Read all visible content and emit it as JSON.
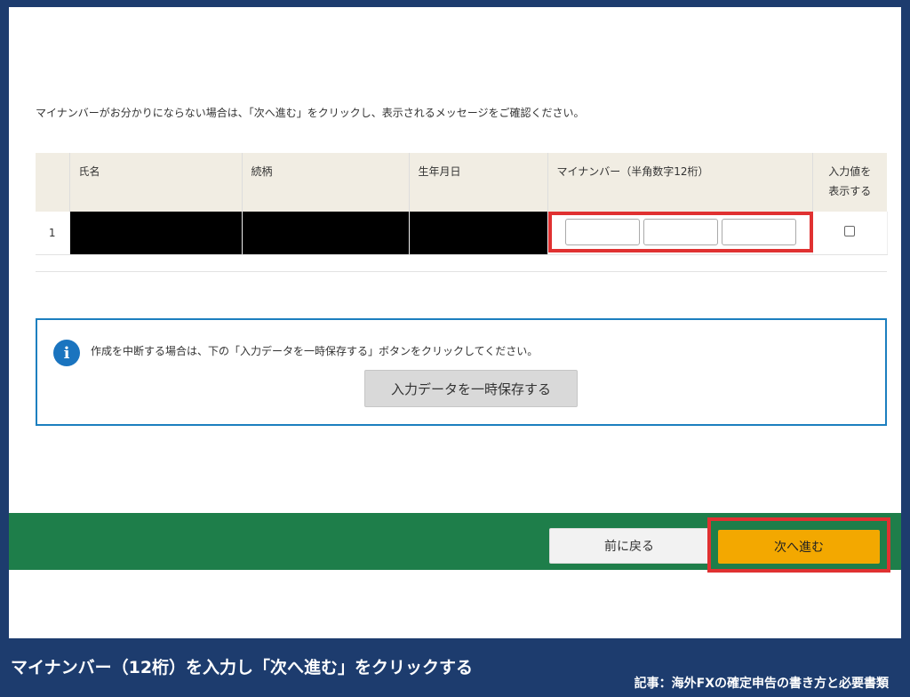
{
  "notice": "マイナンバーがお分かりにならない場合は、「次へ進む」をクリックし、表示されるメッセージをご確認ください。",
  "table": {
    "headers": {
      "name": "氏名",
      "relation": "続柄",
      "birthdate": "生年月日",
      "mynumber": "マイナンバー（半角数字12桁）",
      "show_input_line1": "入力値を",
      "show_input_line2": "表示する"
    },
    "rows": [
      {
        "num": "1"
      }
    ]
  },
  "info_panel": {
    "icon": "info-icon",
    "text": "作成を中断する場合は、下の「入力データを一時保存する」ボタンをクリックしてください。",
    "save_button": "入力データを一時保存する"
  },
  "nav": {
    "back_button": "前に戻る",
    "next_button": "次へ進む"
  },
  "caption": {
    "main": "マイナンバー（12桁）を入力し「次へ進む」をクリックする",
    "article": "記事：海外FXの確定申告の書き方と必要書類"
  },
  "colors": {
    "frame_border": "#1d3c6e",
    "header_bg": "#f1ede3",
    "info_border": "#1c7fbf",
    "nav_bar": "#1e7e4a",
    "next_button": "#f3a800",
    "highlight": "#e03131"
  }
}
